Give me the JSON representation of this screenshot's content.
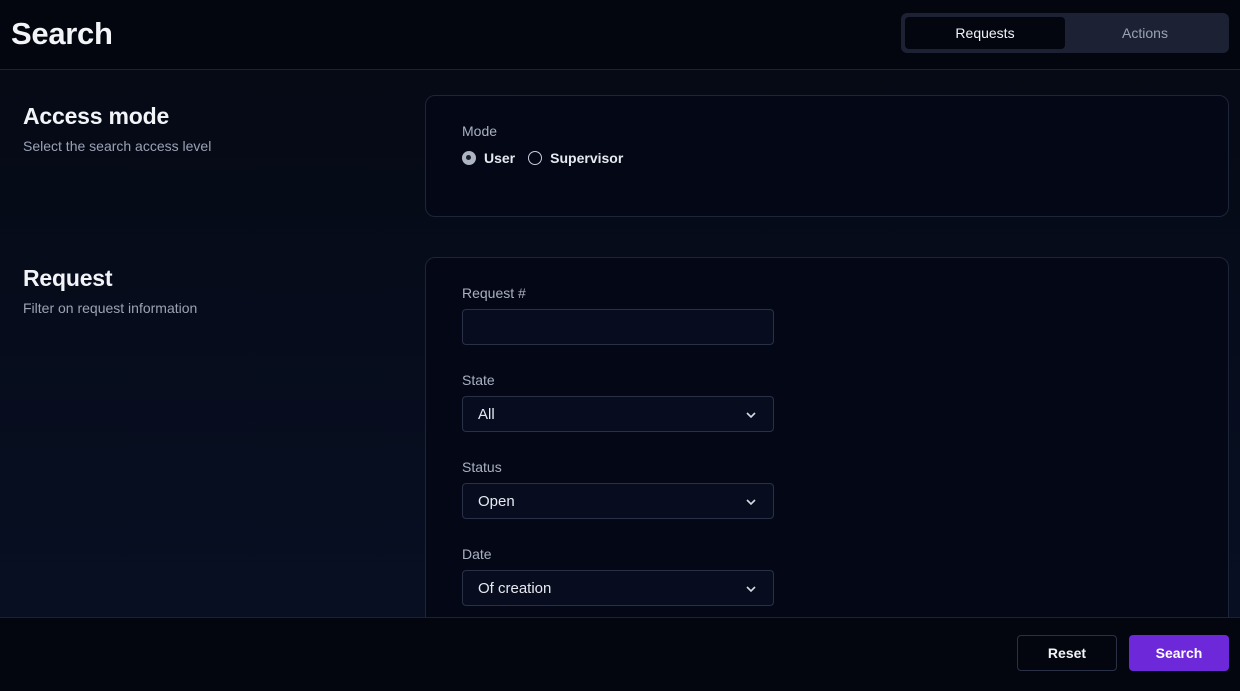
{
  "header": {
    "title": "Search",
    "tabs": [
      {
        "label": "Requests",
        "active": true
      },
      {
        "label": "Actions",
        "active": false
      }
    ]
  },
  "access": {
    "title": "Access mode",
    "description": "Select the search access level",
    "mode_label": "Mode",
    "options": [
      {
        "label": "User",
        "checked": true
      },
      {
        "label": "Supervisor",
        "checked": false
      }
    ]
  },
  "request": {
    "title": "Request",
    "description": "Filter on request information",
    "number_label": "Request #",
    "number_value": "",
    "state_label": "State",
    "state_value": "All",
    "status_label": "Status",
    "status_value": "Open",
    "date_label": "Date",
    "date_value": "Of creation"
  },
  "footer": {
    "reset_label": "Reset",
    "search_label": "Search"
  },
  "colors": {
    "accent": "#6d28d9",
    "background": "#070c1a"
  }
}
